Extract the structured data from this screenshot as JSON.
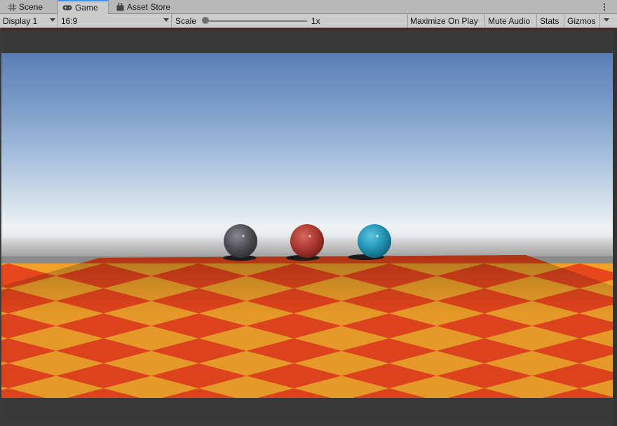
{
  "tabs": [
    {
      "label": "Scene",
      "icon": "grid-icon"
    },
    {
      "label": "Game",
      "icon": "gamepad-icon",
      "active": true
    },
    {
      "label": "Asset Store",
      "icon": "shopping-bag-icon"
    }
  ],
  "toolbar": {
    "display": "Display 1",
    "aspect": "16:9",
    "scale_label": "Scale",
    "scale_value": "1x",
    "maximize_on_play": "Maximize On Play",
    "mute_audio": "Mute Audio",
    "stats": "Stats",
    "gizmos": "Gizmos"
  },
  "scene": {
    "spheres": [
      {
        "name": "gray-sphere",
        "color": "#4a4a50"
      },
      {
        "name": "red-sphere",
        "color": "#a8352c"
      },
      {
        "name": "cyan-sphere",
        "color": "#1e8fb0"
      }
    ],
    "floor_colors": [
      "#e8461c",
      "#f0a12a"
    ],
    "sky_top": "#5a7fb6",
    "sky_horizon": "#eef1f3"
  }
}
